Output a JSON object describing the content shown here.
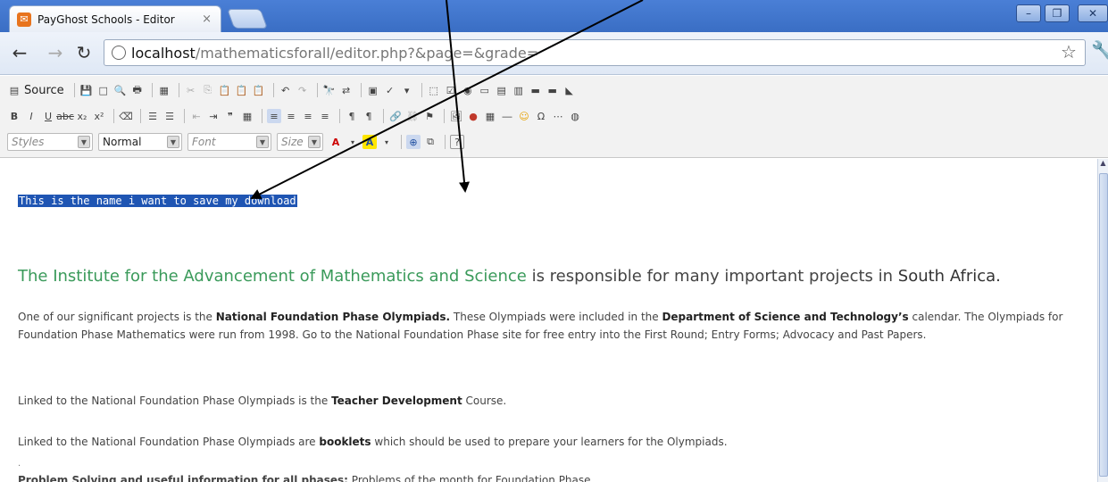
{
  "browser": {
    "tab_title": "PayGhost Schools - Editor",
    "tab_close": "×",
    "favicon_glyph": "✉",
    "url_host": "localhost",
    "url_path": "/mathematicsforall/editor.php?&page=&grade=",
    "window_controls": [
      "–",
      "❐",
      "✕"
    ]
  },
  "toolbar": {
    "source_label": "Source",
    "styles_combo": "Styles",
    "format_combo": "Normal",
    "font_combo": "Font",
    "size_combo": "Size",
    "icon_color": "#4a6fb0"
  },
  "content": {
    "selected_text": "This is the name i want to save my download",
    "heading_green": "The Institute for the Advancement of Mathematics and Science",
    "heading_gray": "is responsible for many important projects in",
    "heading_sa": "South Africa.",
    "para1_a": "One of our significant projects is the ",
    "para1_b": "National Foundation Phase Olympiads.",
    "para1_c": " These Olympiads were included in the ",
    "para1_d": "Department of Science and Technology’s",
    "para1_e": " calendar. The Olympiads for Foundation Phase Mathematics were run from 1998. Go to the National Foundation Phase site for free entry into the First Round; Entry Forms; Advocacy and Past Papers.",
    "para2_a": "Linked to the National Foundation Phase Olympiads is the ",
    "para2_b": "Teacher Development",
    "para2_c": " Course.",
    "para3_a": "Linked to the National Foundation Phase Olympiads are ",
    "para3_b": "booklets",
    "para3_c": " which should be used to prepare your learners for the Olympiads.",
    "dot": ".",
    "cut_a": "Problem Solving and useful information for all phases:",
    "cut_b": " Problems of the month for Foundation Phase"
  }
}
